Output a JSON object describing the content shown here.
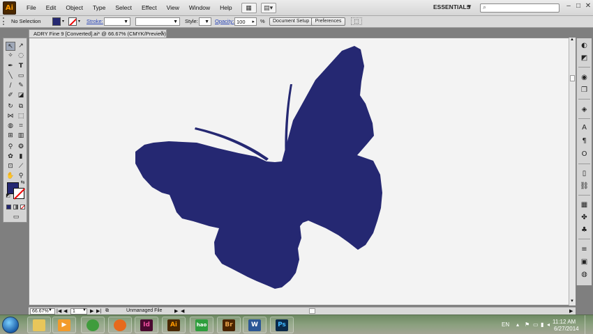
{
  "menubar": {
    "app_logo": "Ai",
    "items": [
      "File",
      "Edit",
      "Object",
      "Type",
      "Select",
      "Effect",
      "View",
      "Window",
      "Help"
    ],
    "workspace": "ESSENTIALS",
    "window_buttons": [
      "–",
      "□",
      "✕"
    ]
  },
  "controlbar": {
    "selection": "No Selection",
    "stroke_label": "Stroke:",
    "style_label": "Style:",
    "opacity_label": "Opacity:",
    "opacity_value": "100",
    "opacity_unit": "%",
    "document_setup": "Document Setup",
    "preferences": "Preferences",
    "fill_color": "#252872"
  },
  "document": {
    "tab_title": "ADRY Fine 9 [Converted].ai* @ 66.67% (CMYK/Preview)",
    "close": "×",
    "artwork_color": "#252872"
  },
  "statusbar": {
    "zoom": "66.67%",
    "page": "1",
    "file_status": "Unmanaged File"
  },
  "taskbar": {
    "apps": [
      {
        "name": "explorer",
        "label": "",
        "bg": "#e8c65a",
        "fg": "#fff"
      },
      {
        "name": "media",
        "label": "▶",
        "bg": "#f29b2b",
        "fg": "#fff"
      },
      {
        "name": "chrome",
        "label": "",
        "bg": "#3f9c3d",
        "fg": "#fff"
      },
      {
        "name": "firefox",
        "label": "",
        "bg": "#e66a1c",
        "fg": "#fff"
      },
      {
        "name": "indesign",
        "label": "Id",
        "bg": "#4a0a30",
        "fg": "#f04fa0"
      },
      {
        "name": "illustrator",
        "label": "Ai",
        "bg": "#4a2800",
        "fg": "#ff9a00"
      },
      {
        "name": "hao123",
        "label": "hao",
        "bg": "#2e9e3d",
        "fg": "#fff"
      },
      {
        "name": "bridge",
        "label": "Br",
        "bg": "#4a2400",
        "fg": "#e8a24a"
      },
      {
        "name": "word",
        "label": "W",
        "bg": "#2b5796",
        "fg": "#fff"
      },
      {
        "name": "photoshop",
        "label": "Ps",
        "bg": "#0a2a4a",
        "fg": "#3fb8ff"
      }
    ],
    "language": "EN",
    "time": "11:12 AM",
    "date": "6/27/2014"
  }
}
